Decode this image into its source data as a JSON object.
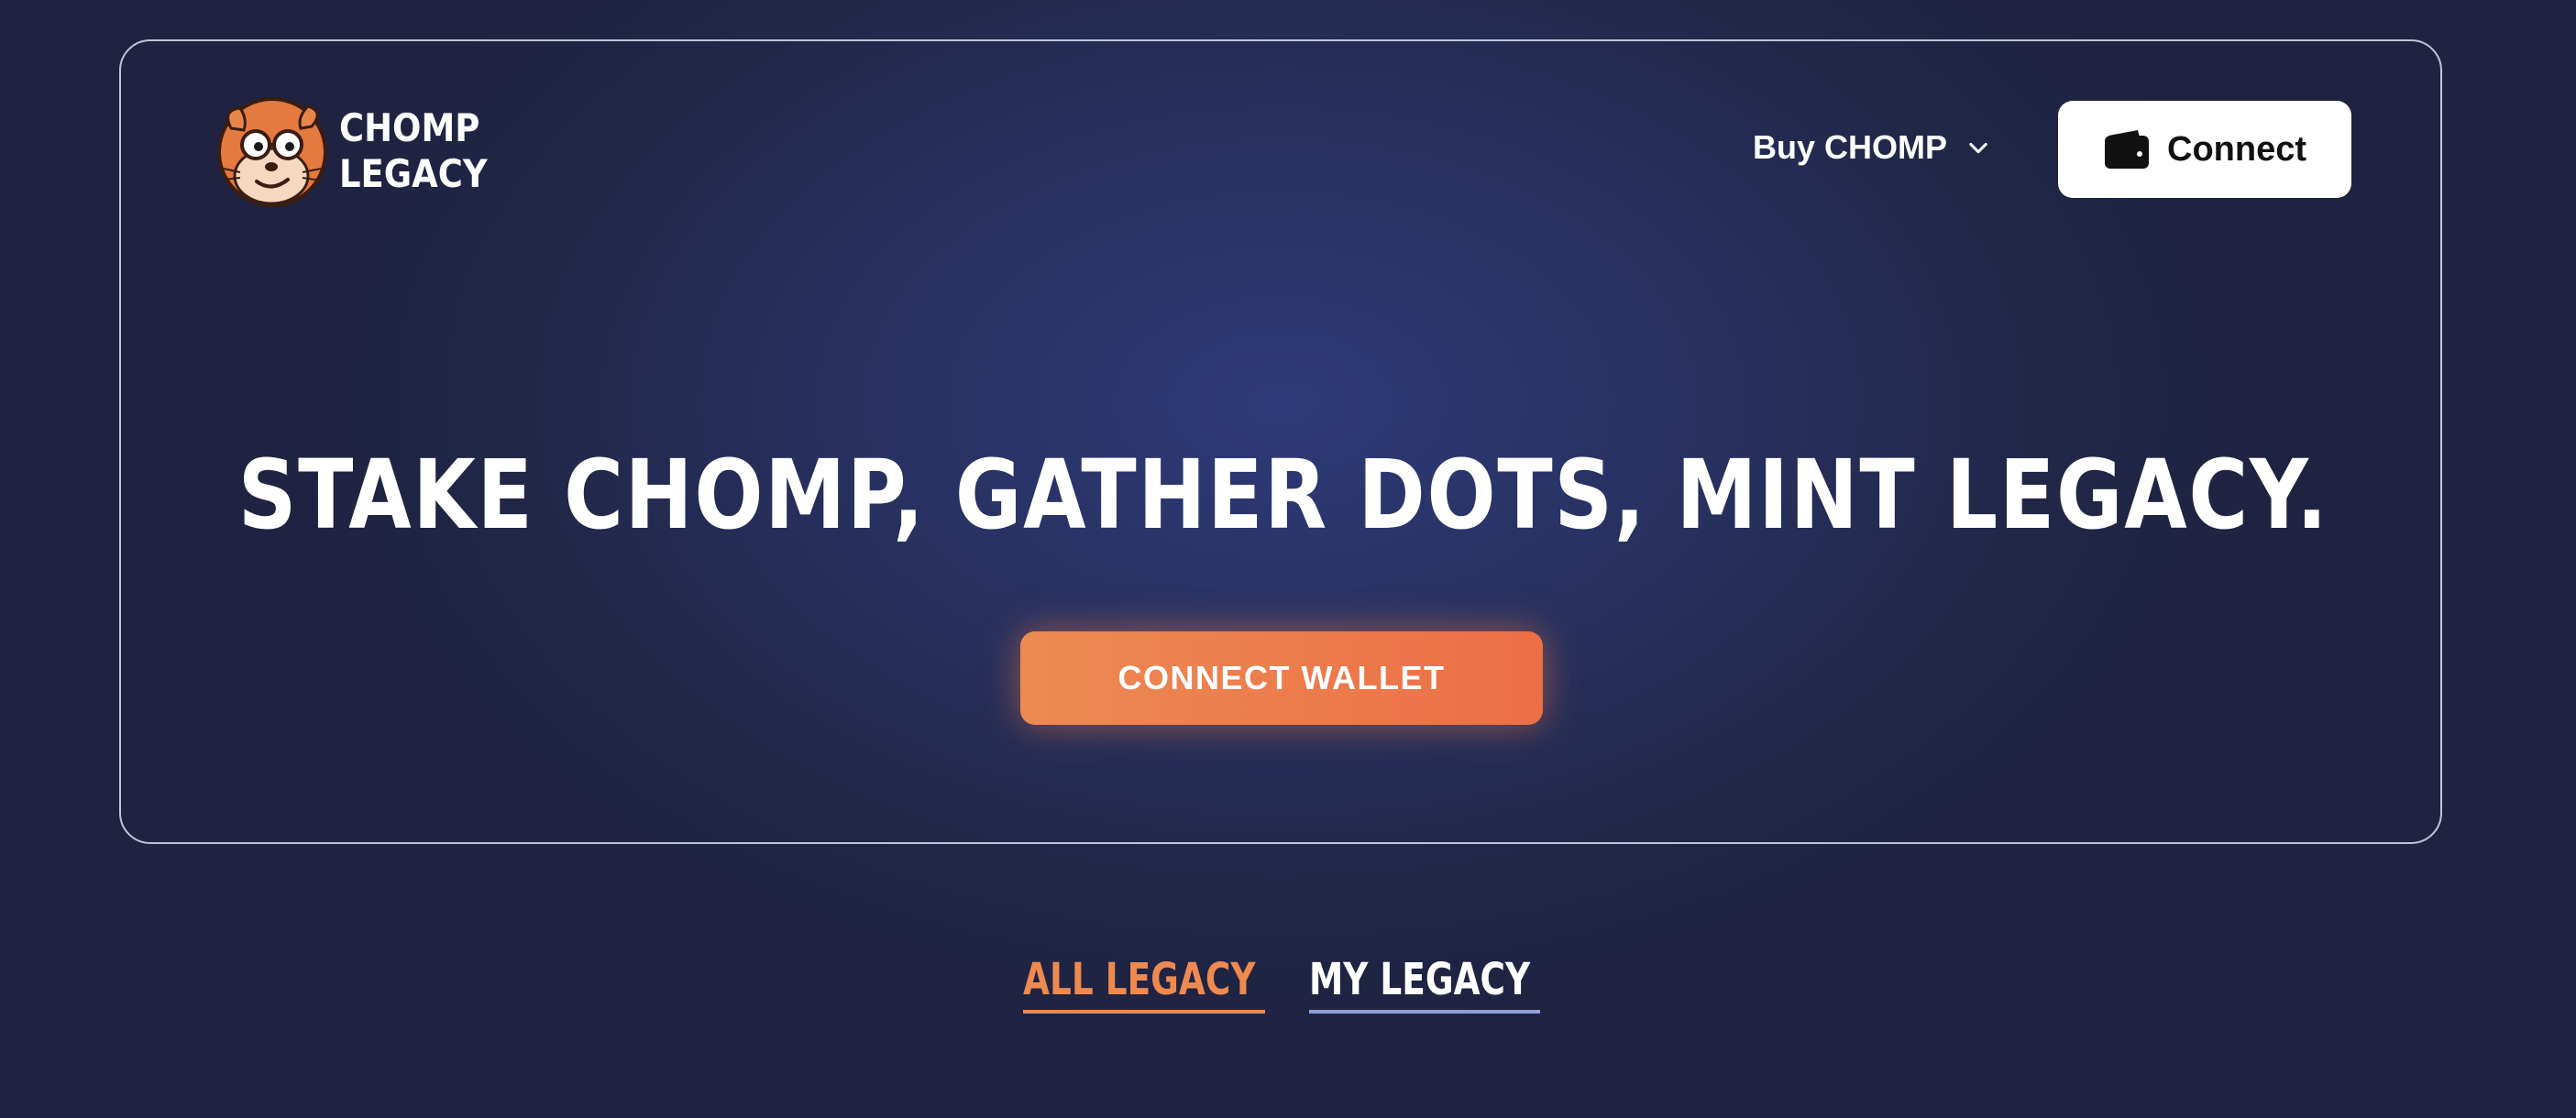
{
  "header": {
    "logo": {
      "line1": "CHOMP",
      "line2": "LEGACY",
      "mascot_icon": "guinea-pig-mascot-icon"
    },
    "buy_menu": {
      "label": "Buy CHOMP",
      "icon": "chevron-down-icon"
    },
    "connect_button": {
      "label": "Connect",
      "icon": "wallet-icon"
    }
  },
  "hero": {
    "headline": "STAKE CHOMP, GATHER DOTS, MINT LEGACY.",
    "cta_label": "CONNECT WALLET"
  },
  "tabs": [
    {
      "label": "ALL LEGACY",
      "active": true
    },
    {
      "label": "MY LEGACY",
      "active": false
    }
  ],
  "colors": {
    "accent_orange": "#ED7A4B",
    "background": "#232848",
    "text_white": "#FFFFFF",
    "inactive_underline": "#8FA0D8"
  }
}
